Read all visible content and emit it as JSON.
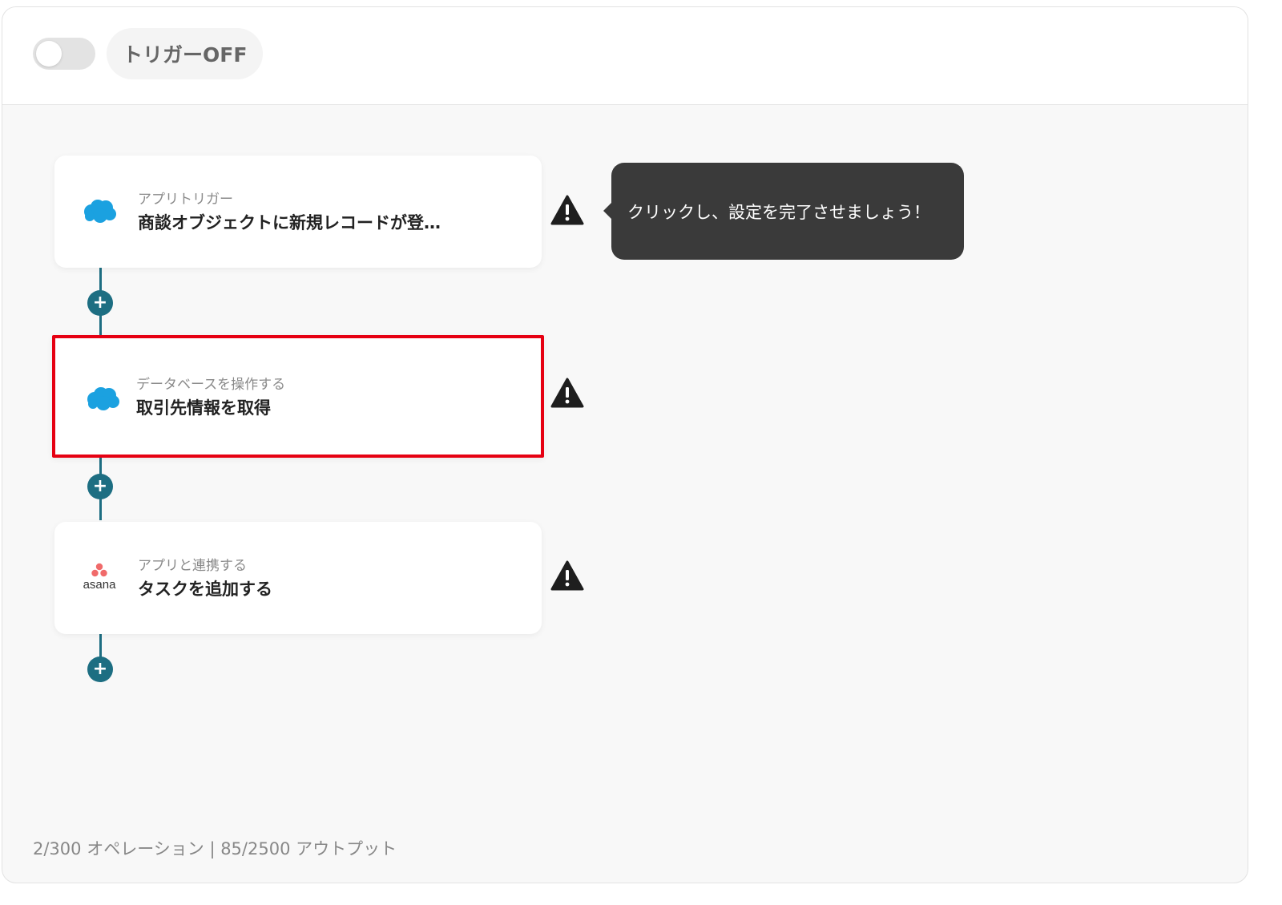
{
  "header": {
    "trigger_toggle_label": "トリガーOFF",
    "trigger_on": false
  },
  "steps": [
    {
      "app_icon": "salesforce-cloud-icon",
      "type_label": "アプリトリガー",
      "title": "商談オブジェクトに新規レコードが登…",
      "warning": true,
      "selected": false
    },
    {
      "app_icon": "salesforce-cloud-icon",
      "type_label": "データベースを操作する",
      "title": "取引先情報を取得",
      "warning": true,
      "selected": true
    },
    {
      "app_icon": "asana-logo",
      "app_name": "asana",
      "type_label": "アプリと連携する",
      "title": "タスクを追加する",
      "warning": true,
      "selected": false
    }
  ],
  "tooltip": {
    "text": "クリックし、設定を完了させましょう！"
  },
  "footer": {
    "usage": "2/300 オペレーション | 85/2500 アウトプット"
  },
  "colors": {
    "accent": "#1d6e82",
    "highlight": "#e60012",
    "salesforce": "#1ba1e0",
    "asana": "#f06a6a",
    "tooltip_bg": "#3a3a3a"
  }
}
